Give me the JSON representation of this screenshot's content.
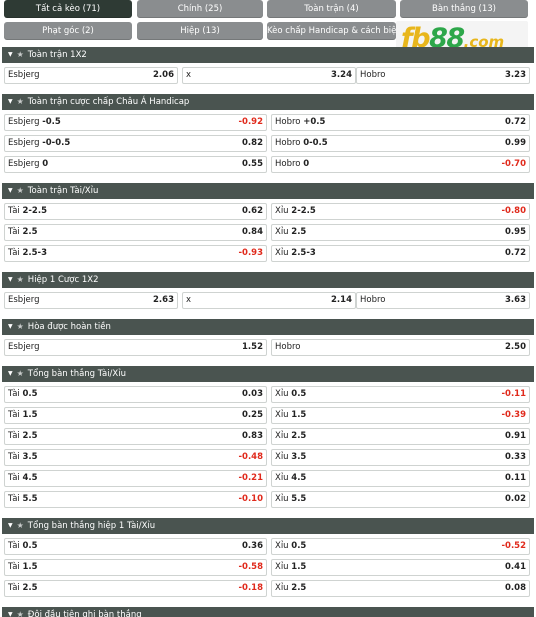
{
  "tabs": [
    {
      "label": "Tất cả kèo (71)",
      "active": true
    },
    {
      "label": "Chính (25)",
      "active": false
    },
    {
      "label": "Toàn trận (4)",
      "active": false
    },
    {
      "label": "Bàn thắng (13)",
      "active": false
    },
    {
      "label": "Phạt góc (2)",
      "active": false
    },
    {
      "label": "Hiệp (13)",
      "active": false
    },
    {
      "label": "Kèo chấp Handicap & cách biệt (3)",
      "active": false
    }
  ],
  "logo": {
    "part1": "fb",
    "part2": "88",
    "part3": ".com"
  },
  "sections": [
    {
      "title": "Toàn trận 1X2",
      "layout": "three",
      "rows": [
        [
          {
            "team": "Esbjerg",
            "line": "",
            "odd": "2.06"
          },
          {
            "team": "x",
            "line": "",
            "odd": "3.24"
          },
          {
            "team": "Hobro",
            "line": "",
            "odd": "3.23"
          }
        ]
      ]
    },
    {
      "title": "Toàn trận cược chấp Châu Á Handicap",
      "layout": "two",
      "rows": [
        [
          {
            "team": "Esbjerg",
            "line": "-0.5",
            "odd": "-0.92"
          },
          {
            "team": "Hobro",
            "line": "+0.5",
            "odd": "0.72"
          }
        ],
        [
          {
            "team": "Esbjerg",
            "line": "-0-0.5",
            "odd": "0.82"
          },
          {
            "team": "Hobro",
            "line": "0-0.5",
            "odd": "0.99"
          }
        ],
        [
          {
            "team": "Esbjerg",
            "line": "0",
            "odd": "0.55"
          },
          {
            "team": "Hobro",
            "line": "0",
            "odd": "-0.70"
          }
        ]
      ]
    },
    {
      "title": "Toàn trận Tài/Xỉu",
      "layout": "two",
      "rows": [
        [
          {
            "team": "Tài",
            "line": "2-2.5",
            "odd": "0.62"
          },
          {
            "team": "Xỉu",
            "line": "2-2.5",
            "odd": "-0.80"
          }
        ],
        [
          {
            "team": "Tài",
            "line": "2.5",
            "odd": "0.84"
          },
          {
            "team": "Xỉu",
            "line": "2.5",
            "odd": "0.95"
          }
        ],
        [
          {
            "team": "Tài",
            "line": "2.5-3",
            "odd": "-0.93"
          },
          {
            "team": "Xỉu",
            "line": "2.5-3",
            "odd": "0.72"
          }
        ]
      ]
    },
    {
      "title": "Hiệp 1 Cược 1X2",
      "layout": "three",
      "rows": [
        [
          {
            "team": "Esbjerg",
            "line": "",
            "odd": "2.63"
          },
          {
            "team": "x",
            "line": "",
            "odd": "2.14"
          },
          {
            "team": "Hobro",
            "line": "",
            "odd": "3.63"
          }
        ]
      ]
    },
    {
      "title": "Hòa được hoàn tiền",
      "layout": "two",
      "rows": [
        [
          {
            "team": "Esbjerg",
            "line": "",
            "odd": "1.52"
          },
          {
            "team": "Hobro",
            "line": "",
            "odd": "2.50"
          }
        ]
      ]
    },
    {
      "title": "Tổng bàn thắng Tài/Xỉu",
      "layout": "two",
      "rows": [
        [
          {
            "team": "Tài",
            "line": "0.5",
            "odd": "0.03"
          },
          {
            "team": "Xỉu",
            "line": "0.5",
            "odd": "-0.11"
          }
        ],
        [
          {
            "team": "Tài",
            "line": "1.5",
            "odd": "0.25"
          },
          {
            "team": "Xỉu",
            "line": "1.5",
            "odd": "-0.39"
          }
        ],
        [
          {
            "team": "Tài",
            "line": "2.5",
            "odd": "0.83"
          },
          {
            "team": "Xỉu",
            "line": "2.5",
            "odd": "0.91"
          }
        ],
        [
          {
            "team": "Tài",
            "line": "3.5",
            "odd": "-0.48"
          },
          {
            "team": "Xỉu",
            "line": "3.5",
            "odd": "0.33"
          }
        ],
        [
          {
            "team": "Tài",
            "line": "4.5",
            "odd": "-0.21"
          },
          {
            "team": "Xỉu",
            "line": "4.5",
            "odd": "0.11"
          }
        ],
        [
          {
            "team": "Tài",
            "line": "5.5",
            "odd": "-0.10"
          },
          {
            "team": "Xỉu",
            "line": "5.5",
            "odd": "0.02"
          }
        ]
      ]
    },
    {
      "title": "Tổng bàn thắng hiệp 1 Tài/Xỉu",
      "layout": "two",
      "rows": [
        [
          {
            "team": "Tài",
            "line": "0.5",
            "odd": "0.36"
          },
          {
            "team": "Xỉu",
            "line": "0.5",
            "odd": "-0.52"
          }
        ],
        [
          {
            "team": "Tài",
            "line": "1.5",
            "odd": "-0.58"
          },
          {
            "team": "Xỉu",
            "line": "1.5",
            "odd": "0.41"
          }
        ],
        [
          {
            "team": "Tài",
            "line": "2.5",
            "odd": "-0.18"
          },
          {
            "team": "Xỉu",
            "line": "2.5",
            "odd": "0.08"
          }
        ]
      ]
    },
    {
      "title": "Đội đầu tiên ghi bàn thắng",
      "layout": "two",
      "rows": []
    }
  ],
  "colors": {
    "header": "#4a5450",
    "tab": "#8a8d8f",
    "tab_active": "#2e3a34",
    "negative": "#e02a1c",
    "logo_gold": "#e8b61b",
    "logo_green": "#2da74a"
  }
}
